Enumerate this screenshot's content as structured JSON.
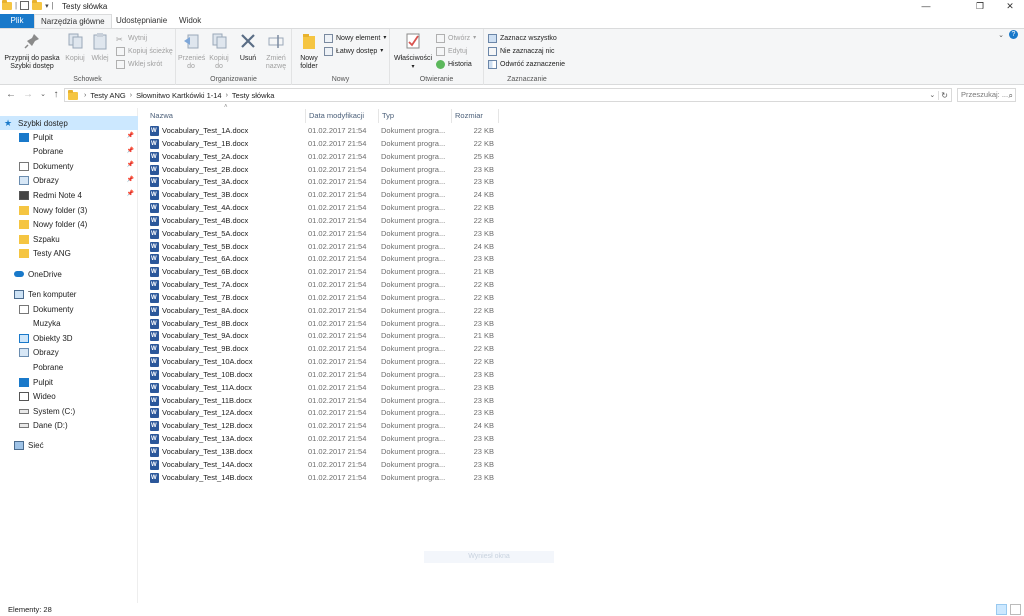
{
  "window": {
    "title": "Testy słówka",
    "controls": {
      "minimize": "—",
      "maximize": "❐",
      "close": "✕"
    }
  },
  "tabs": [
    {
      "label": "Plik"
    },
    {
      "label": "Narzędzia główne"
    },
    {
      "label": "Udostępnianie"
    },
    {
      "label": "Widok"
    }
  ],
  "ribbon": {
    "schowek": {
      "label": "Schowek",
      "pin": "Przypnij do paska Szybki dostęp",
      "copy": "Kopiuj",
      "paste": "Wklej",
      "cut": "Wytnij",
      "copy_path": "Kopiuj ścieżkę",
      "paste_shortcut": "Wklej skrót"
    },
    "organizowanie": {
      "label": "Organizowanie",
      "move_to": "Przenieś do",
      "copy_to": "Kopiuj do",
      "delete": "Usuń",
      "rename": "Zmień nazwę"
    },
    "nowy": {
      "label": "Nowy",
      "new_folder": "Nowy folder",
      "new_item": "Nowy element",
      "easy_access": "Łatwy dostęp"
    },
    "otwieranie": {
      "label": "Otwieranie",
      "properties": "Właściwości",
      "open": "Otwórz",
      "edit": "Edytuj",
      "history": "Historia"
    },
    "zaznaczanie": {
      "label": "Zaznaczanie",
      "select_all": "Zaznacz wszystko",
      "select_none": "Nie zaznaczaj nic",
      "invert": "Odwróć zaznaczenie"
    }
  },
  "address": {
    "crumbs": [
      "Testy ANG",
      "Słownitwo Kartkówki 1-14",
      "Testy słówka"
    ],
    "search_placeholder": "Przeszukaj: ..."
  },
  "nav": {
    "quick_access": "Szybki dostęp",
    "quick_items": [
      {
        "label": "Pulpit",
        "icon": "desktop-icon",
        "pinned": true
      },
      {
        "label": "Pobrane",
        "icon": "download-icon",
        "pinned": true
      },
      {
        "label": "Dokumenty",
        "icon": "documents-icon",
        "pinned": true
      },
      {
        "label": "Obrazy",
        "icon": "pictures-icon",
        "pinned": true
      },
      {
        "label": "Redmi Note 4",
        "icon": "phone-icon",
        "pinned": true
      },
      {
        "label": "Nowy folder (3)",
        "icon": "folder-icon",
        "pinned": false
      },
      {
        "label": "Nowy folder (4)",
        "icon": "folder-icon",
        "pinned": false
      },
      {
        "label": "Szpaku",
        "icon": "folder-icon",
        "pinned": false
      },
      {
        "label": "Testy ANG",
        "icon": "folder-icon",
        "pinned": false
      }
    ],
    "onedrive": "OneDrive",
    "this_pc": "Ten komputer",
    "pc_items": [
      {
        "label": "Dokumenty",
        "icon": "documents-icon"
      },
      {
        "label": "Muzyka",
        "icon": "music-icon"
      },
      {
        "label": "Obiekty 3D",
        "icon": "3d-objects-icon"
      },
      {
        "label": "Obrazy",
        "icon": "pictures-icon"
      },
      {
        "label": "Pobrane",
        "icon": "download-icon"
      },
      {
        "label": "Pulpit",
        "icon": "desktop-icon"
      },
      {
        "label": "Wideo",
        "icon": "video-icon"
      },
      {
        "label": "System (C:)",
        "icon": "drive-icon"
      },
      {
        "label": "Dane (D:)",
        "icon": "drive-icon"
      }
    ],
    "network": "Sieć"
  },
  "columns": {
    "name": "Nazwa",
    "date": "Data modyfikacji",
    "type": "Typ",
    "size": "Rozmiar"
  },
  "files": [
    {
      "name": "Vocabulary_Test_1A.docx",
      "date": "01.02.2017 21:54",
      "type": "Dokument progra...",
      "size": "22 KB"
    },
    {
      "name": "Vocabulary_Test_1B.docx",
      "date": "01.02.2017 21:54",
      "type": "Dokument progra...",
      "size": "22 KB"
    },
    {
      "name": "Vocabulary_Test_2A.docx",
      "date": "01.02.2017 21:54",
      "type": "Dokument progra...",
      "size": "25 KB"
    },
    {
      "name": "Vocabulary_Test_2B.docx",
      "date": "01.02.2017 21:54",
      "type": "Dokument progra...",
      "size": "23 KB"
    },
    {
      "name": "Vocabulary_Test_3A.docx",
      "date": "01.02.2017 21:54",
      "type": "Dokument progra...",
      "size": "23 KB"
    },
    {
      "name": "Vocabulary_Test_3B.docx",
      "date": "01.02.2017 21:54",
      "type": "Dokument progra...",
      "size": "24 KB"
    },
    {
      "name": "Vocabulary_Test_4A.docx",
      "date": "01.02.2017 21:54",
      "type": "Dokument progra...",
      "size": "22 KB"
    },
    {
      "name": "Vocabulary_Test_4B.docx",
      "date": "01.02.2017 21:54",
      "type": "Dokument progra...",
      "size": "22 KB"
    },
    {
      "name": "Vocabulary_Test_5A.docx",
      "date": "01.02.2017 21:54",
      "type": "Dokument progra...",
      "size": "23 KB"
    },
    {
      "name": "Vocabulary_Test_5B.docx",
      "date": "01.02.2017 21:54",
      "type": "Dokument progra...",
      "size": "24 KB"
    },
    {
      "name": "Vocabulary_Test_6A.docx",
      "date": "01.02.2017 21:54",
      "type": "Dokument progra...",
      "size": "23 KB"
    },
    {
      "name": "Vocabulary_Test_6B.docx",
      "date": "01.02.2017 21:54",
      "type": "Dokument progra...",
      "size": "21 KB"
    },
    {
      "name": "Vocabulary_Test_7A.docx",
      "date": "01.02.2017 21:54",
      "type": "Dokument progra...",
      "size": "22 KB"
    },
    {
      "name": "Vocabulary_Test_7B.docx",
      "date": "01.02.2017 21:54",
      "type": "Dokument progra...",
      "size": "22 KB"
    },
    {
      "name": "Vocabulary_Test_8A.docx",
      "date": "01.02.2017 21:54",
      "type": "Dokument progra...",
      "size": "22 KB"
    },
    {
      "name": "Vocabulary_Test_8B.docx",
      "date": "01.02.2017 21:54",
      "type": "Dokument progra...",
      "size": "23 KB"
    },
    {
      "name": "Vocabulary_Test_9A.docx",
      "date": "01.02.2017 21:54",
      "type": "Dokument progra...",
      "size": "21 KB"
    },
    {
      "name": "Vocabulary_Test_9B.docx",
      "date": "01.02.2017 21:54",
      "type": "Dokument progra...",
      "size": "22 KB"
    },
    {
      "name": "Vocabulary_Test_10A.docx",
      "date": "01.02.2017 21:54",
      "type": "Dokument progra...",
      "size": "22 KB"
    },
    {
      "name": "Vocabulary_Test_10B.docx",
      "date": "01.02.2017 21:54",
      "type": "Dokument progra...",
      "size": "23 KB"
    },
    {
      "name": "Vocabulary_Test_11A.docx",
      "date": "01.02.2017 21:54",
      "type": "Dokument progra...",
      "size": "23 KB"
    },
    {
      "name": "Vocabulary_Test_11B.docx",
      "date": "01.02.2017 21:54",
      "type": "Dokument progra...",
      "size": "23 KB"
    },
    {
      "name": "Vocabulary_Test_12A.docx",
      "date": "01.02.2017 21:54",
      "type": "Dokument progra...",
      "size": "23 KB"
    },
    {
      "name": "Vocabulary_Test_12B.docx",
      "date": "01.02.2017 21:54",
      "type": "Dokument progra...",
      "size": "24 KB"
    },
    {
      "name": "Vocabulary_Test_13A.docx",
      "date": "01.02.2017 21:54",
      "type": "Dokument progra...",
      "size": "23 KB"
    },
    {
      "name": "Vocabulary_Test_13B.docx",
      "date": "01.02.2017 21:54",
      "type": "Dokument progra...",
      "size": "23 KB"
    },
    {
      "name": "Vocabulary_Test_14A.docx",
      "date": "01.02.2017 21:54",
      "type": "Dokument progra...",
      "size": "23 KB"
    },
    {
      "name": "Vocabulary_Test_14B.docx",
      "date": "01.02.2017 21:54",
      "type": "Dokument progra...",
      "size": "23 KB"
    }
  ],
  "preview_note": "Wyniesł okna",
  "status": {
    "count": "Elementy: 28"
  },
  "colors": {
    "accent": "#1979ca",
    "selection": "#cce8ff",
    "folder": "#f5c542",
    "word": "#2b579a"
  }
}
